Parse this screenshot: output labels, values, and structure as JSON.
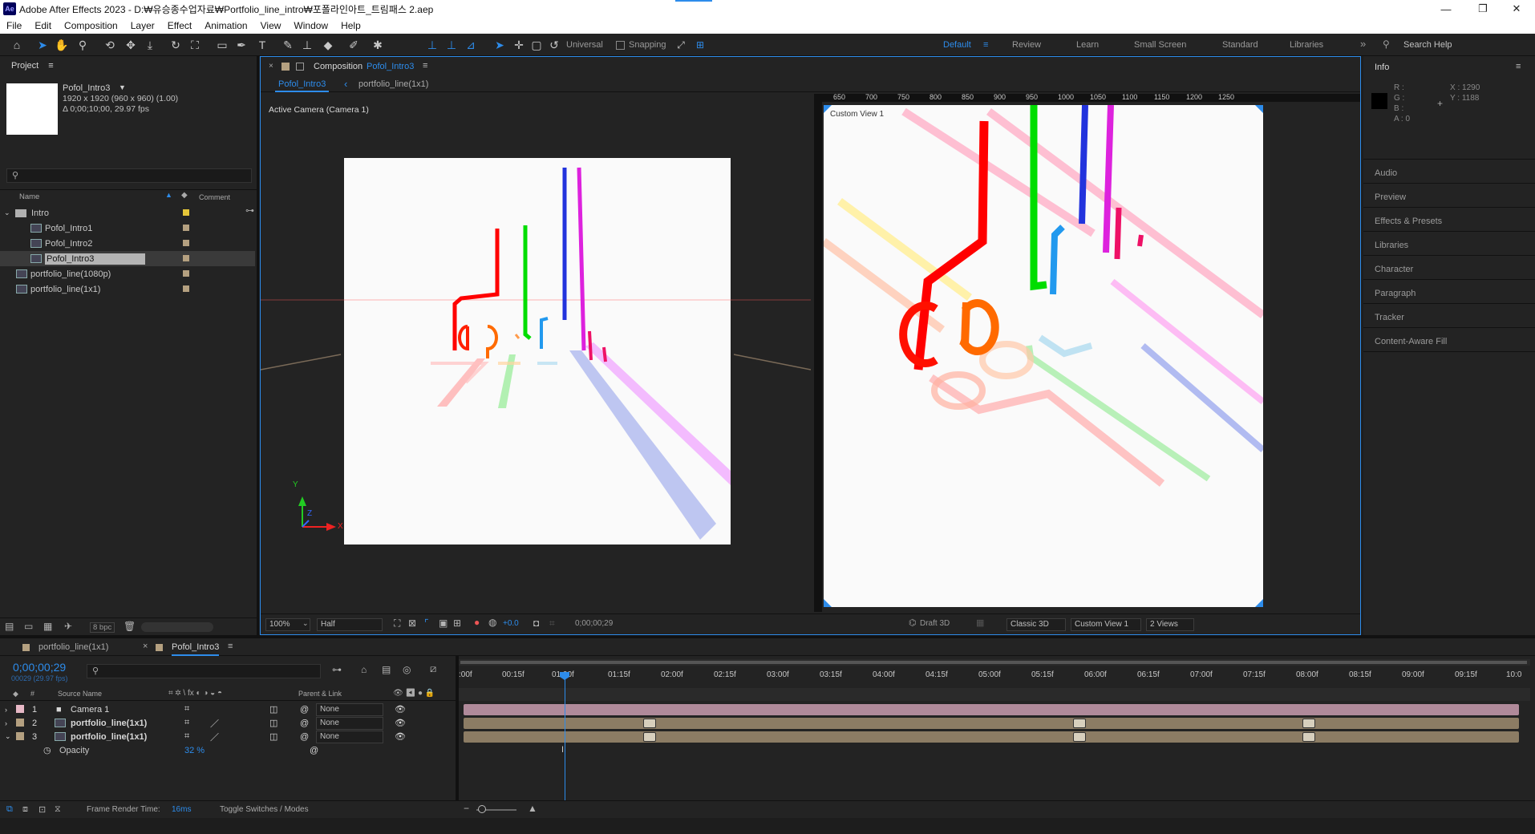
{
  "titlebar": {
    "app_badge": "Ae",
    "title": "Adobe After Effects 2023 - D:₩유승종수업자료₩Portfolio_line_intro₩포폴라인아트_트림패스 2.aep"
  },
  "menu": [
    "File",
    "Edit",
    "Composition",
    "Layer",
    "Effect",
    "Animation",
    "View",
    "Window",
    "Help"
  ],
  "toolbar": {
    "universal_label": "Universal",
    "snapping_label": "Snapping",
    "workspaces": [
      "Default",
      "Review",
      "Learn",
      "Small Screen",
      "Standard",
      "Libraries"
    ],
    "search_placeholder": "Search Help"
  },
  "project": {
    "panel_title": "Project",
    "comp_name": "Pofol_Intro3",
    "comp_size": "1920 x 1920  (960 x 960) (1.00)",
    "comp_duration": "Δ 0;00;10;00, 29.97 fps",
    "col_name": "Name",
    "col_comment": "Comment",
    "items": [
      {
        "name": "Intro",
        "type": "folder",
        "indent": 0,
        "color": "#e5c639"
      },
      {
        "name": "Pofol_Intro1",
        "type": "comp",
        "indent": 1,
        "color": "#b4a080"
      },
      {
        "name": "Pofol_Intro2",
        "type": "comp",
        "indent": 1,
        "color": "#b4a080"
      },
      {
        "name": "Pofol_Intro3",
        "type": "comp",
        "indent": 1,
        "color": "#b4a080",
        "selected": true
      },
      {
        "name": "portfolio_line(1080p)",
        "type": "comp",
        "indent": 0,
        "color": "#b4a080"
      },
      {
        "name": "portfolio_line(1x1)",
        "type": "comp",
        "indent": 0,
        "color": "#b4a080"
      }
    ],
    "bpc": "8 bpc"
  },
  "comp": {
    "panel_label": "Composition",
    "comp_name": "Pofol_Intro3",
    "tabs": [
      "Pofol_Intro3",
      "portfolio_line(1x1)"
    ],
    "left_view_label": "Active Camera (Camera 1)",
    "right_view_label": "Custom View 1",
    "axis_x": "X",
    "axis_y": "Y",
    "axis_z": "Z",
    "ruler_ticks": [
      "650",
      "700",
      "750",
      "800",
      "850",
      "900",
      "950",
      "1000",
      "1050",
      "1100",
      "1150",
      "1200",
      "1250"
    ],
    "footer": {
      "zoom": "100%",
      "resolution": "Half",
      "exposure": "+0.0",
      "timecode": "0;00;00;29",
      "draft": "Draft 3D",
      "renderer": "Classic 3D",
      "view": "Custom View 1",
      "layout": "2 Views"
    }
  },
  "info": {
    "title": "Info",
    "r": "R :",
    "g": "G :",
    "b": "B :",
    "a": "A :  0",
    "x": "X : 1290",
    "y": "Y : 1188",
    "panels": [
      "Audio",
      "Preview",
      "Effects & Presets",
      "Libraries",
      "Character",
      "Paragraph",
      "Tracker",
      "Content-Aware Fill"
    ]
  },
  "timeline": {
    "tabs": [
      "portfolio_line(1x1)",
      "Pofol_Intro3"
    ],
    "timecode": "0;00;00;29",
    "frame_info": "00029 (29.97 fps)",
    "col_source": "Source Name",
    "col_parent": "Parent & Link",
    "layers": [
      {
        "num": "1",
        "name": "Camera 1",
        "parent": "None",
        "color": "#e7b8c6"
      },
      {
        "num": "2",
        "name": "portfolio_line(1x1)",
        "parent": "None",
        "color": "#b4a080"
      },
      {
        "num": "3",
        "name": "portfolio_line(1x1)",
        "parent": "None",
        "color": "#b4a080"
      }
    ],
    "property": {
      "name": "Opacity",
      "value": "32 %"
    },
    "ruler": [
      ":00f",
      "00:15f",
      "01:00f",
      "01:15f",
      "02:00f",
      "02:15f",
      "03:00f",
      "03:15f",
      "04:00f",
      "04:15f",
      "05:00f",
      "05:15f",
      "06:00f",
      "06:15f",
      "07:00f",
      "07:15f",
      "08:00f",
      "08:15f",
      "09:00f",
      "09:15f",
      "10:0"
    ],
    "render_time_label": "Frame Render Time:",
    "render_time": "16ms",
    "toggle_label": "Toggle Switches / Modes"
  },
  "colors": {
    "accent": "#2d8ceb",
    "lines": [
      "#ff0000",
      "#ff6600",
      "#00dd00",
      "#2299ee",
      "#2233dd",
      "#dd22dd",
      "#ee1166"
    ]
  }
}
